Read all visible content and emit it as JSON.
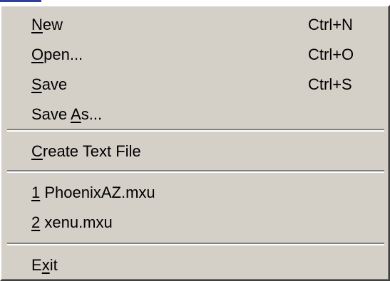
{
  "menu": {
    "items": [
      {
        "pre": "",
        "accel": "N",
        "post": "ew",
        "shortcut": "Ctrl+N"
      },
      {
        "pre": "",
        "accel": "O",
        "post": "pen...",
        "shortcut": "Ctrl+O"
      },
      {
        "pre": "",
        "accel": "S",
        "post": "ave",
        "shortcut": "Ctrl+S"
      },
      {
        "pre": "Save ",
        "accel": "A",
        "post": "s...",
        "shortcut": ""
      },
      {
        "pre": "",
        "accel": "C",
        "post": "reate Text File",
        "shortcut": ""
      },
      {
        "pre": "",
        "accel": "1",
        "post": " PhoenixAZ.mxu",
        "shortcut": ""
      },
      {
        "pre": "",
        "accel": "2",
        "post": " xenu.mxu",
        "shortcut": ""
      },
      {
        "pre": "E",
        "accel": "x",
        "post": "it",
        "shortcut": ""
      }
    ]
  }
}
